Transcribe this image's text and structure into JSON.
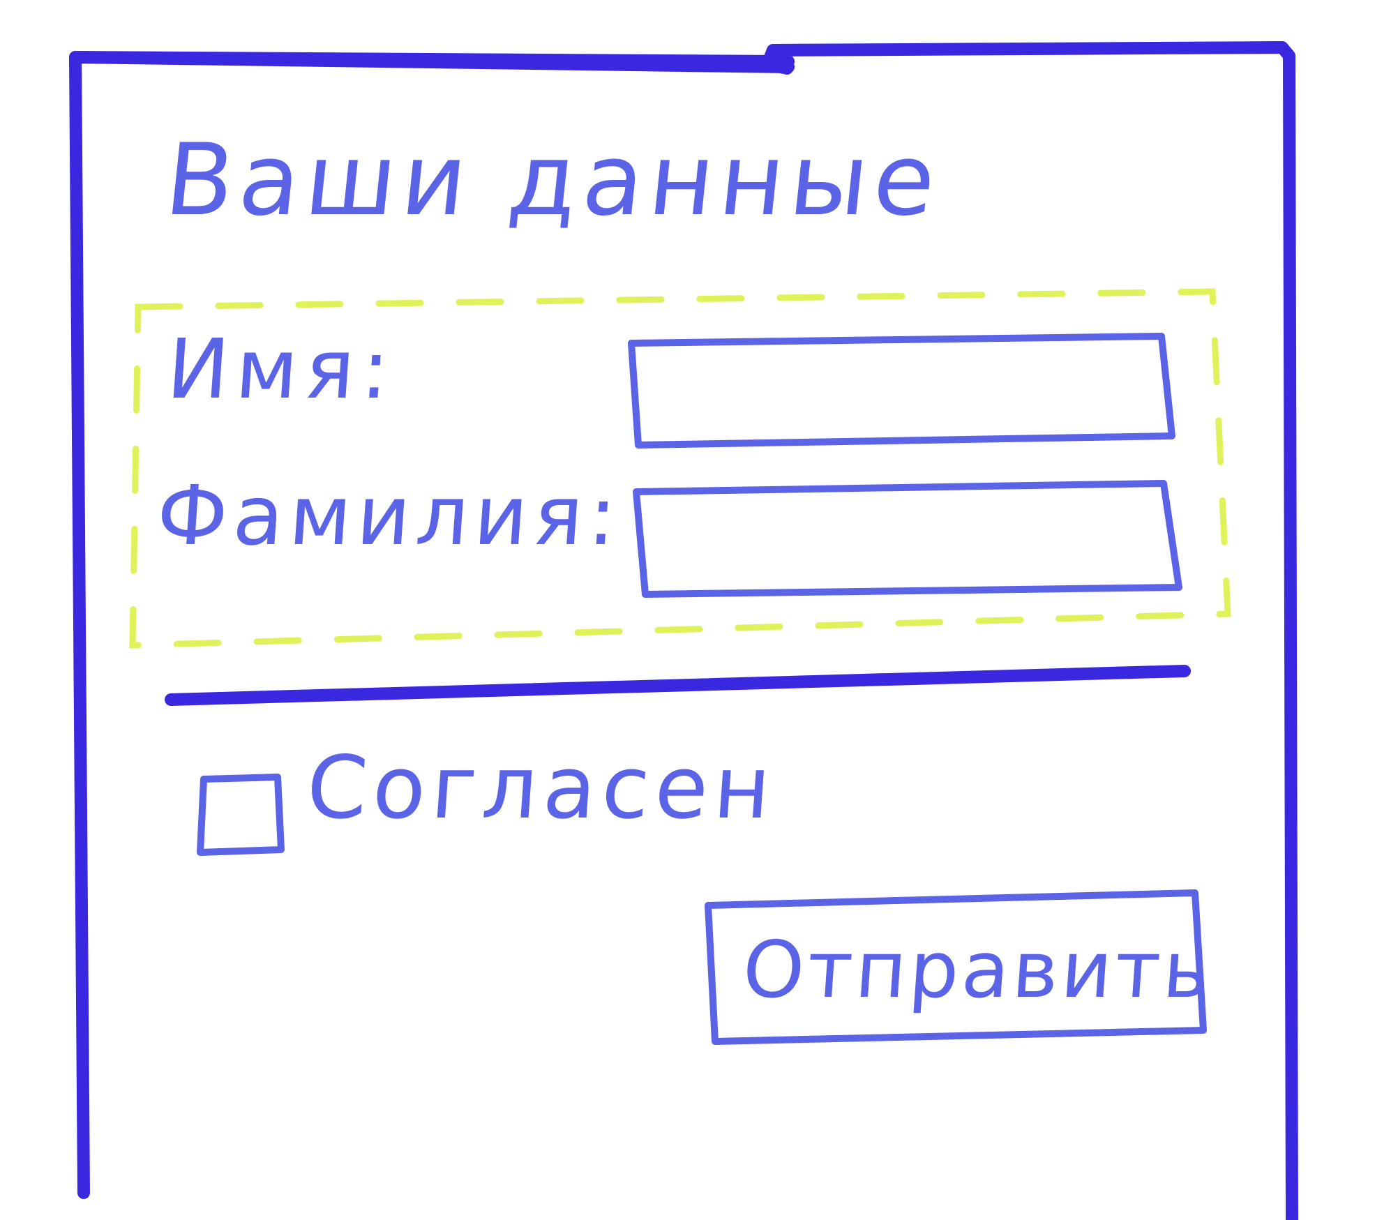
{
  "form": {
    "title": "Ваши данные",
    "fields": {
      "first_name": {
        "label": "Имя:",
        "value": ""
      },
      "last_name": {
        "label": "Фамилия:",
        "value": ""
      }
    },
    "agree": {
      "label": "Согласен",
      "checked": false
    },
    "submit_label": "Отправить"
  },
  "colors": {
    "outline": "#3a28e0",
    "ink": "#5b63e6",
    "group_highlight": "#dff25a",
    "background": "#ffffff"
  }
}
